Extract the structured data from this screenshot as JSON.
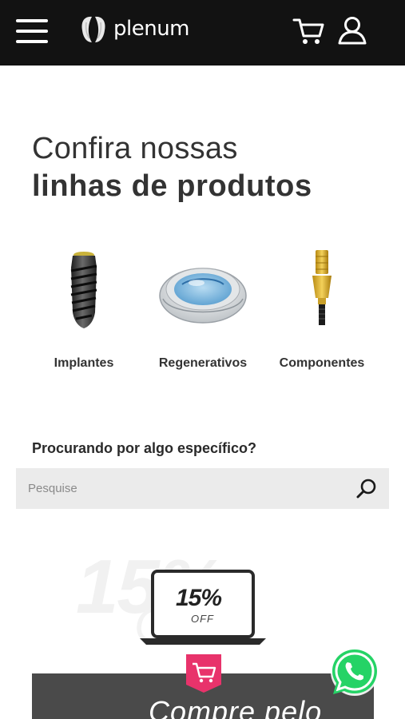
{
  "header": {
    "brand": "plenum",
    "icons": [
      "hamburger-menu-icon",
      "plenum-logo",
      "cart-icon",
      "user-icon"
    ],
    "background": "#121212"
  },
  "headline": {
    "line1": "Confira nossas",
    "line2": "linhas de produtos"
  },
  "products": [
    {
      "label": "Implantes",
      "icon": "implant-image"
    },
    {
      "label": "Regenerativos",
      "icon": "regenerative-membrane-image"
    },
    {
      "label": "Componentes",
      "icon": "component-abutment-image"
    }
  ],
  "search": {
    "title": "Procurando por algo específico?",
    "placeholder": "Pesquise",
    "value": ""
  },
  "promo": {
    "discount": "15%",
    "off": "OFF",
    "cta": "Compre pelo",
    "panel_color": "#4a4a4a",
    "badge_color": "#e8336b"
  },
  "whatsapp": {
    "icon": "whatsapp-icon",
    "color": "#25d366"
  }
}
